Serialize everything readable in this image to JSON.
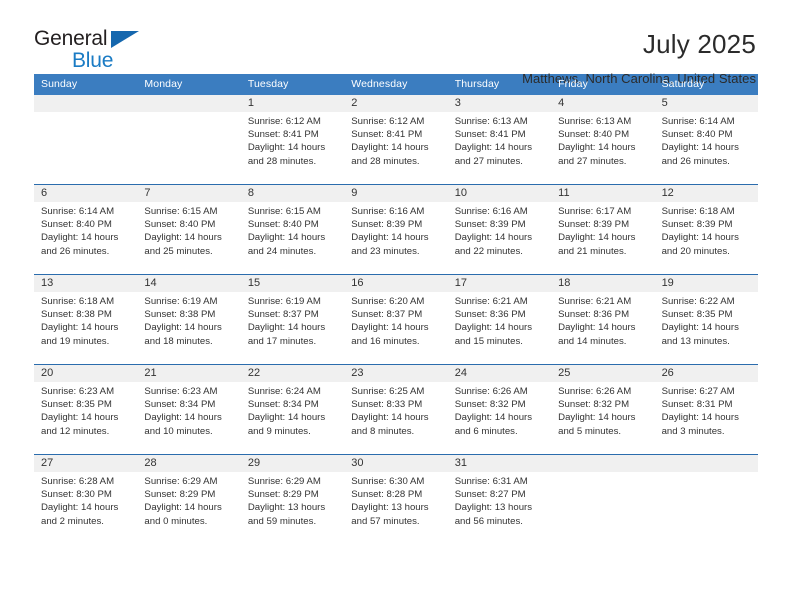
{
  "brand": {
    "name_part1": "General",
    "name_part2": "Blue"
  },
  "header": {
    "title": "July 2025",
    "subtitle": "Matthews, North Carolina, United States"
  },
  "weekdays": [
    "Sunday",
    "Monday",
    "Tuesday",
    "Wednesday",
    "Thursday",
    "Friday",
    "Saturday"
  ],
  "colors": {
    "header_blue": "#3b7dc0",
    "row_rule_blue": "#2b6cad",
    "band_gray": "#f0f0f0",
    "logo_blue": "#1a7bc4",
    "text": "#333333"
  },
  "weeks": [
    [
      {
        "day": "",
        "lines": []
      },
      {
        "day": "",
        "lines": []
      },
      {
        "day": "1",
        "lines": [
          "Sunrise: 6:12 AM",
          "Sunset: 8:41 PM",
          "Daylight: 14 hours",
          "and 28 minutes."
        ]
      },
      {
        "day": "2",
        "lines": [
          "Sunrise: 6:12 AM",
          "Sunset: 8:41 PM",
          "Daylight: 14 hours",
          "and 28 minutes."
        ]
      },
      {
        "day": "3",
        "lines": [
          "Sunrise: 6:13 AM",
          "Sunset: 8:41 PM",
          "Daylight: 14 hours",
          "and 27 minutes."
        ]
      },
      {
        "day": "4",
        "lines": [
          "Sunrise: 6:13 AM",
          "Sunset: 8:40 PM",
          "Daylight: 14 hours",
          "and 27 minutes."
        ]
      },
      {
        "day": "5",
        "lines": [
          "Sunrise: 6:14 AM",
          "Sunset: 8:40 PM",
          "Daylight: 14 hours",
          "and 26 minutes."
        ]
      }
    ],
    [
      {
        "day": "6",
        "lines": [
          "Sunrise: 6:14 AM",
          "Sunset: 8:40 PM",
          "Daylight: 14 hours",
          "and 26 minutes."
        ]
      },
      {
        "day": "7",
        "lines": [
          "Sunrise: 6:15 AM",
          "Sunset: 8:40 PM",
          "Daylight: 14 hours",
          "and 25 minutes."
        ]
      },
      {
        "day": "8",
        "lines": [
          "Sunrise: 6:15 AM",
          "Sunset: 8:40 PM",
          "Daylight: 14 hours",
          "and 24 minutes."
        ]
      },
      {
        "day": "9",
        "lines": [
          "Sunrise: 6:16 AM",
          "Sunset: 8:39 PM",
          "Daylight: 14 hours",
          "and 23 minutes."
        ]
      },
      {
        "day": "10",
        "lines": [
          "Sunrise: 6:16 AM",
          "Sunset: 8:39 PM",
          "Daylight: 14 hours",
          "and 22 minutes."
        ]
      },
      {
        "day": "11",
        "lines": [
          "Sunrise: 6:17 AM",
          "Sunset: 8:39 PM",
          "Daylight: 14 hours",
          "and 21 minutes."
        ]
      },
      {
        "day": "12",
        "lines": [
          "Sunrise: 6:18 AM",
          "Sunset: 8:39 PM",
          "Daylight: 14 hours",
          "and 20 minutes."
        ]
      }
    ],
    [
      {
        "day": "13",
        "lines": [
          "Sunrise: 6:18 AM",
          "Sunset: 8:38 PM",
          "Daylight: 14 hours",
          "and 19 minutes."
        ]
      },
      {
        "day": "14",
        "lines": [
          "Sunrise: 6:19 AM",
          "Sunset: 8:38 PM",
          "Daylight: 14 hours",
          "and 18 minutes."
        ]
      },
      {
        "day": "15",
        "lines": [
          "Sunrise: 6:19 AM",
          "Sunset: 8:37 PM",
          "Daylight: 14 hours",
          "and 17 minutes."
        ]
      },
      {
        "day": "16",
        "lines": [
          "Sunrise: 6:20 AM",
          "Sunset: 8:37 PM",
          "Daylight: 14 hours",
          "and 16 minutes."
        ]
      },
      {
        "day": "17",
        "lines": [
          "Sunrise: 6:21 AM",
          "Sunset: 8:36 PM",
          "Daylight: 14 hours",
          "and 15 minutes."
        ]
      },
      {
        "day": "18",
        "lines": [
          "Sunrise: 6:21 AM",
          "Sunset: 8:36 PM",
          "Daylight: 14 hours",
          "and 14 minutes."
        ]
      },
      {
        "day": "19",
        "lines": [
          "Sunrise: 6:22 AM",
          "Sunset: 8:35 PM",
          "Daylight: 14 hours",
          "and 13 minutes."
        ]
      }
    ],
    [
      {
        "day": "20",
        "lines": [
          "Sunrise: 6:23 AM",
          "Sunset: 8:35 PM",
          "Daylight: 14 hours",
          "and 12 minutes."
        ]
      },
      {
        "day": "21",
        "lines": [
          "Sunrise: 6:23 AM",
          "Sunset: 8:34 PM",
          "Daylight: 14 hours",
          "and 10 minutes."
        ]
      },
      {
        "day": "22",
        "lines": [
          "Sunrise: 6:24 AM",
          "Sunset: 8:34 PM",
          "Daylight: 14 hours",
          "and 9 minutes."
        ]
      },
      {
        "day": "23",
        "lines": [
          "Sunrise: 6:25 AM",
          "Sunset: 8:33 PM",
          "Daylight: 14 hours",
          "and 8 minutes."
        ]
      },
      {
        "day": "24",
        "lines": [
          "Sunrise: 6:26 AM",
          "Sunset: 8:32 PM",
          "Daylight: 14 hours",
          "and 6 minutes."
        ]
      },
      {
        "day": "25",
        "lines": [
          "Sunrise: 6:26 AM",
          "Sunset: 8:32 PM",
          "Daylight: 14 hours",
          "and 5 minutes."
        ]
      },
      {
        "day": "26",
        "lines": [
          "Sunrise: 6:27 AM",
          "Sunset: 8:31 PM",
          "Daylight: 14 hours",
          "and 3 minutes."
        ]
      }
    ],
    [
      {
        "day": "27",
        "lines": [
          "Sunrise: 6:28 AM",
          "Sunset: 8:30 PM",
          "Daylight: 14 hours",
          "and 2 minutes."
        ]
      },
      {
        "day": "28",
        "lines": [
          "Sunrise: 6:29 AM",
          "Sunset: 8:29 PM",
          "Daylight: 14 hours",
          "and 0 minutes."
        ]
      },
      {
        "day": "29",
        "lines": [
          "Sunrise: 6:29 AM",
          "Sunset: 8:29 PM",
          "Daylight: 13 hours",
          "and 59 minutes."
        ]
      },
      {
        "day": "30",
        "lines": [
          "Sunrise: 6:30 AM",
          "Sunset: 8:28 PM",
          "Daylight: 13 hours",
          "and 57 minutes."
        ]
      },
      {
        "day": "31",
        "lines": [
          "Sunrise: 6:31 AM",
          "Sunset: 8:27 PM",
          "Daylight: 13 hours",
          "and 56 minutes."
        ]
      },
      {
        "day": "",
        "lines": []
      },
      {
        "day": "",
        "lines": []
      }
    ]
  ]
}
